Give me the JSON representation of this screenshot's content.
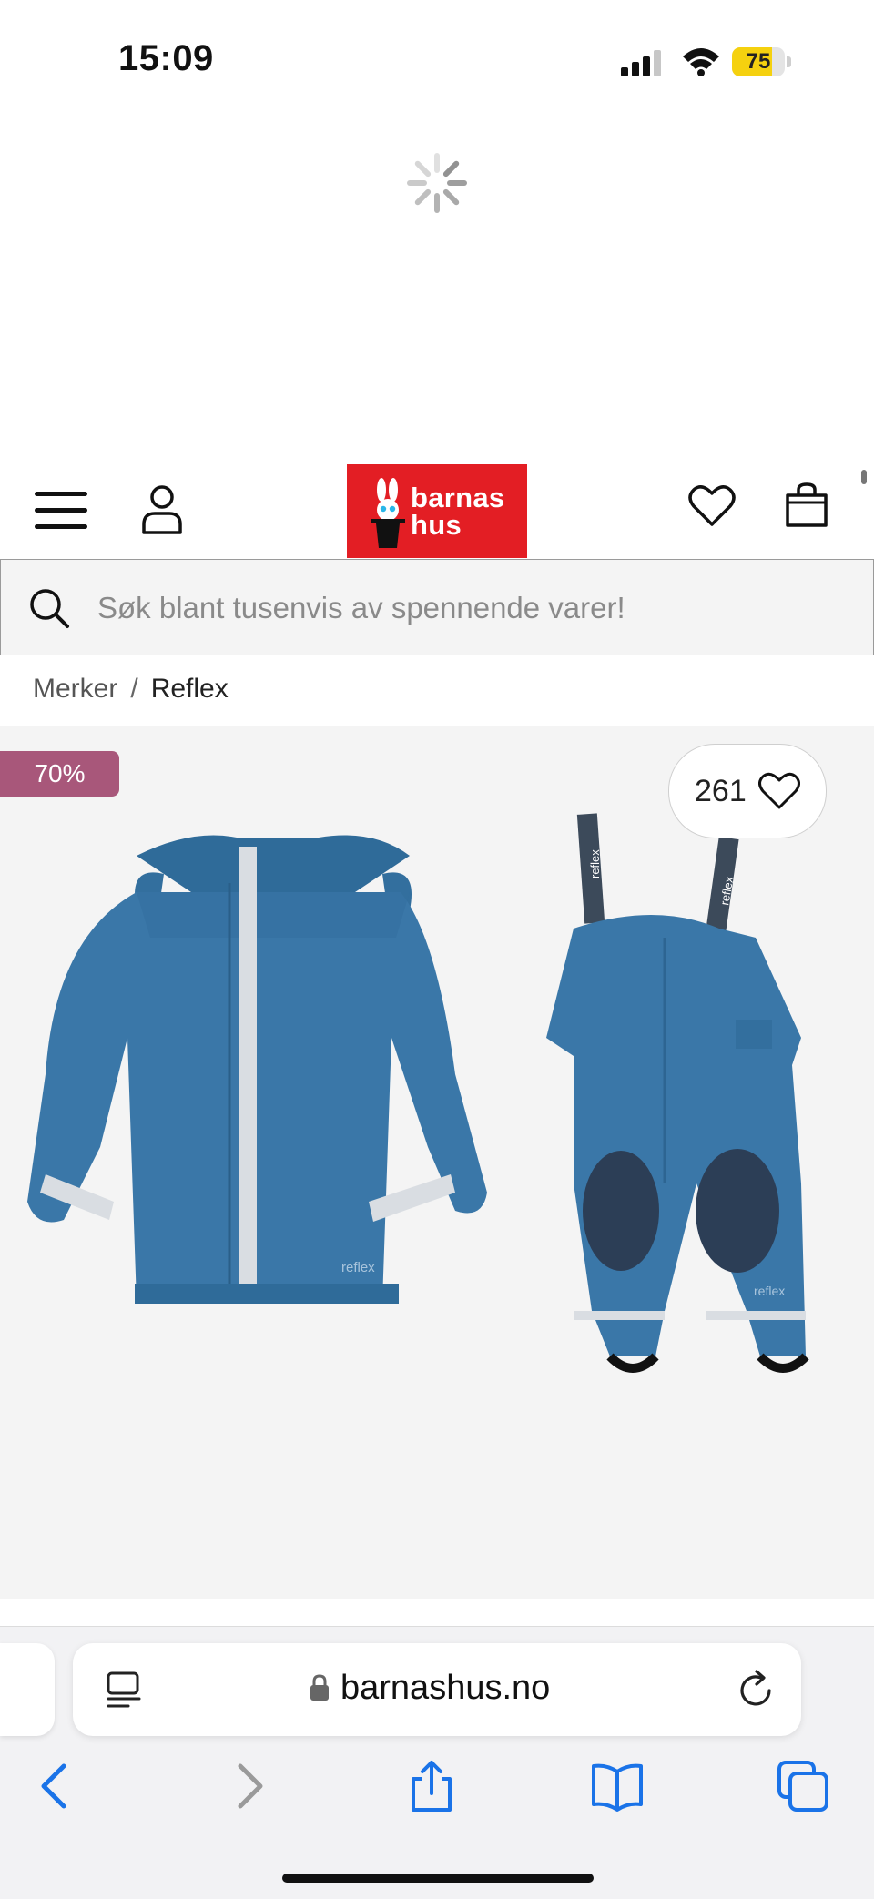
{
  "status_bar": {
    "time": "15:09",
    "battery_percent": "75"
  },
  "header": {
    "logo_line1": "barnas",
    "logo_line2": "hus",
    "icons": {
      "menu": "hamburger-menu-icon",
      "account": "user-icon",
      "wishlist": "heart-icon",
      "cart": "shopping-bag-icon"
    }
  },
  "search": {
    "placeholder": "Søk blant tusenvis av spennende varer!"
  },
  "breadcrumb": {
    "items": [
      "Merker",
      "Reflex"
    ],
    "separator": "/"
  },
  "product": {
    "discount_badge": "70%",
    "wishlist_count": "261",
    "image_name": "reflex-rain-set-jacket-and-bib-pants"
  },
  "browser": {
    "url": "barnashus.no"
  },
  "colors": {
    "brand_red": "#e31e24",
    "discount_badge": "#a8577a",
    "ios_blue": "#1a73e8",
    "battery_yellow": "#f5d10f",
    "product_blue": "#3a77a8"
  }
}
